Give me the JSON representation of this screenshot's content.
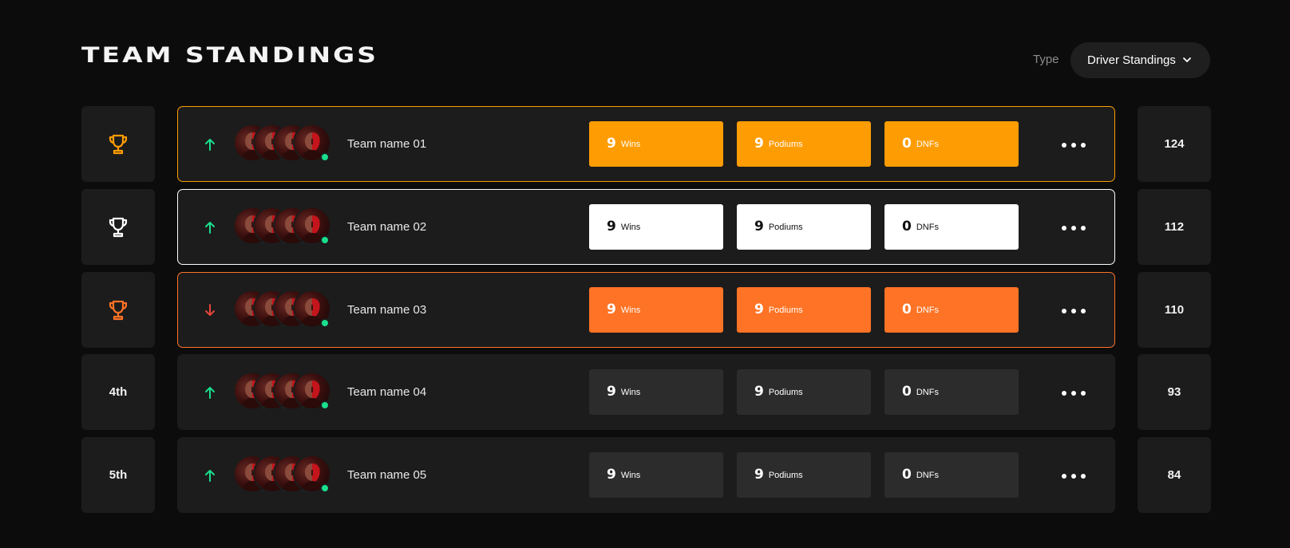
{
  "header": {
    "title": "TEAM STANDINGS",
    "type_label": "Type",
    "type_value": "Driver Standings"
  },
  "colors": {
    "gold": "#fe9c03",
    "silver": "#ffffff",
    "bronze": "#fe7325",
    "default_stat": "#2c2c2c",
    "trend_up": "#19df8e",
    "trend_down": "#e5453a",
    "online": "#19df8e"
  },
  "rows": [
    {
      "rank": "",
      "rank_icon": "trophy-icon",
      "tier": "gold",
      "trend": "up",
      "team_name": "Team name 01",
      "wins": "9",
      "wins_label": "Wins",
      "podiums": "9",
      "podiums_label": "Podiums",
      "dnfs": "0",
      "dnfs_label": "DNFs",
      "points": "124"
    },
    {
      "rank": "",
      "rank_icon": "trophy-icon",
      "tier": "silver",
      "trend": "up",
      "team_name": "Team name 02",
      "wins": "9",
      "wins_label": "Wins",
      "podiums": "9",
      "podiums_label": "Podiums",
      "dnfs": "0",
      "dnfs_label": "DNFs",
      "points": "112"
    },
    {
      "rank": "",
      "rank_icon": "trophy-icon",
      "tier": "bronze",
      "trend": "down",
      "team_name": "Team name 03",
      "wins": "9",
      "wins_label": "Wins",
      "podiums": "9",
      "podiums_label": "Podiums",
      "dnfs": "0",
      "dnfs_label": "DNFs",
      "points": "110"
    },
    {
      "rank": "4th",
      "rank_icon": "",
      "tier": "default",
      "trend": "up",
      "team_name": "Team name 04",
      "wins": "9",
      "wins_label": "Wins",
      "podiums": "9",
      "podiums_label": "Podiums",
      "dnfs": "0",
      "dnfs_label": "DNFs",
      "points": "93"
    },
    {
      "rank": "5th",
      "rank_icon": "",
      "tier": "default",
      "trend": "up",
      "team_name": "Team name 05",
      "wins": "9",
      "wins_label": "Wins",
      "podiums": "9",
      "podiums_label": "Podiums",
      "dnfs": "0",
      "dnfs_label": "DNFs",
      "points": "84"
    }
  ]
}
